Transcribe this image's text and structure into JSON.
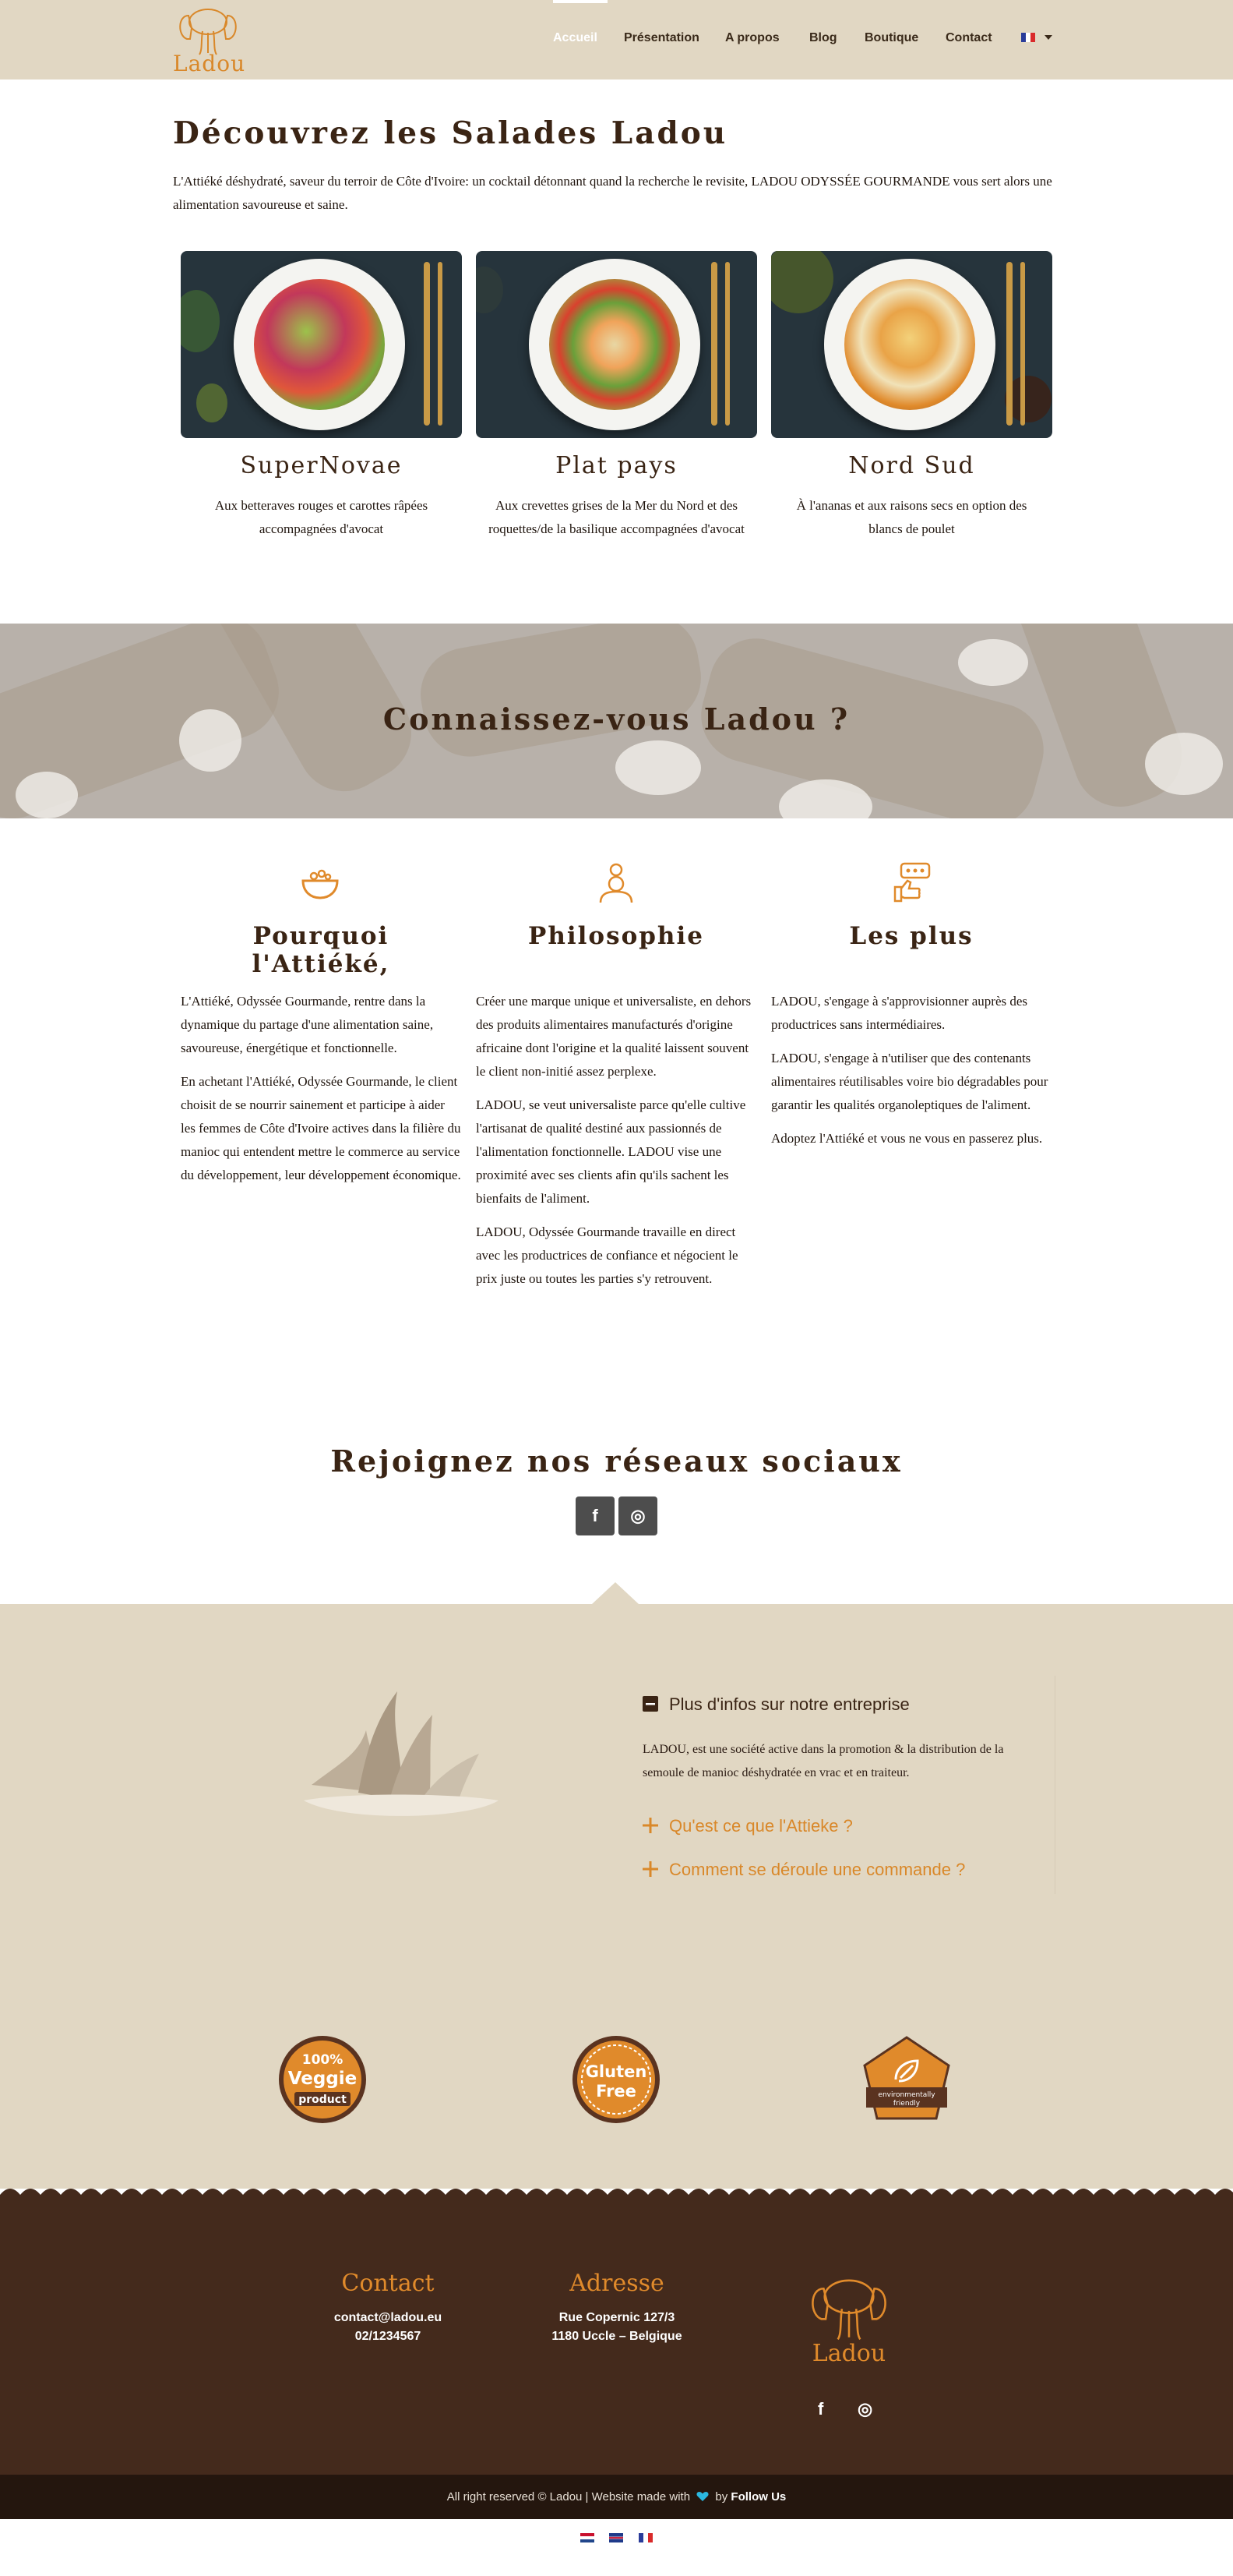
{
  "header": {
    "logo_text": "Ladou",
    "nav": [
      "Accueil",
      "Présentation",
      "A propos",
      "Blog",
      "Boutique",
      "Contact"
    ],
    "active_nav": "Accueil"
  },
  "intro": {
    "title": "Découvrez les Salades Ladou",
    "text": "L'Attiéké déshydraté, saveur du terroir de Côte d'Ivoire: un cocktail détonnant quand la recherche le revisite, LADOU ODYSSÉE GOURMANDE vous sert alors une alimentation savoureuse et saine."
  },
  "salads": [
    {
      "name": "SuperNovae",
      "description": "Aux betteraves rouges et carottes râpées accompagnées d'avocat"
    },
    {
      "name": "Plat pays",
      "description": "Aux crevettes grises de la Mer du Nord et des roquettes/de la basilique accompagnées d'avocat"
    },
    {
      "name": "Nord Sud",
      "description": "À l'ananas et aux raisons secs en option des blancs de poulet"
    }
  ],
  "banner": {
    "title": "Connaissez-vous Ladou ?"
  },
  "columns": [
    {
      "title": "Pourquoi l'Attiéké,",
      "icon": "bowl-icon",
      "paragraphs": [
        "L'Attiéké, Odyssée Gourmande, rentre dans la dynamique du partage d'une alimentation saine, savoureuse, énergétique et fonctionnelle.",
        "En achetant l'Attiéké, Odyssée Gourmande, le client choisit de se nourrir sainement et participe à aider les femmes de Côte d'Ivoire actives dans la filière du manioc qui entendent mettre le commerce au service du développement, leur développement économique."
      ]
    },
    {
      "title": "Philosophie",
      "icon": "thinker-icon",
      "paragraphs": [
        "Créer une marque unique et universaliste, en dehors des produits alimentaires manufacturés d'origine africaine dont l'origine et la qualité laissent souvent le client non-initié assez perplexe.",
        "LADOU, se veut universaliste parce qu'elle cultive l'artisanat de qualité destiné aux passionnés de l'alimentation fonctionnelle. LADOU vise une proximité avec ses clients afin qu'ils sachent les bienfaits de l'aliment.",
        "LADOU, Odyssée Gourmande travaille en direct avec les productrices de confiance et négocient le prix juste ou toutes les parties s'y retrouvent."
      ]
    },
    {
      "title": "Les plus",
      "icon": "thumbs-up-icon",
      "paragraphs": [
        "LADOU, s'engage à s'approvisionner auprès des productrices sans intermédiaires.",
        "LADOU, s'engage à n'utiliser que des contenants alimentaires réutilisables voire bio dégradables pour garantir les qualités organoleptiques de l'aliment.",
        "Adoptez l'Attiéké et vous ne vous en passerez plus."
      ]
    }
  ],
  "social": {
    "title": "Rejoignez nos réseaux sociaux",
    "facebook": "f",
    "instagram": "◎"
  },
  "accordion": {
    "open_title": "Plus d'infos sur notre entreprise",
    "open_text": "LADOU, est une société active dans la promotion & la distribution de la semoule de manioc déshydratée en vrac et en traiteur.",
    "closed": [
      "Qu'est ce que l'Attieke ?",
      "Comment se déroule une commande ?"
    ]
  },
  "badges": [
    {
      "lines": [
        "100%",
        "Veggie",
        "product"
      ]
    },
    {
      "lines": [
        "Gluten",
        "Free"
      ]
    },
    {
      "lines": [
        "environmentally",
        "friendly"
      ]
    }
  ],
  "footer": {
    "contact_title": "Contact",
    "contact_email": "contact@ladou.eu",
    "contact_phone": "02/1234567",
    "address_title": "Adresse",
    "address_line1": "Rue Copernic 127/3",
    "address_line2": "1180 Uccle – Belgique",
    "logo_text": "Ladou",
    "copyright": "All right reserved © Ladou | Website made with",
    "by": "by",
    "maker": "Follow Us"
  },
  "colors": {
    "beige": "#e1d7c3",
    "brown": "#442a1c",
    "orange": "#d9882a",
    "dark_text": "#3a2414"
  }
}
